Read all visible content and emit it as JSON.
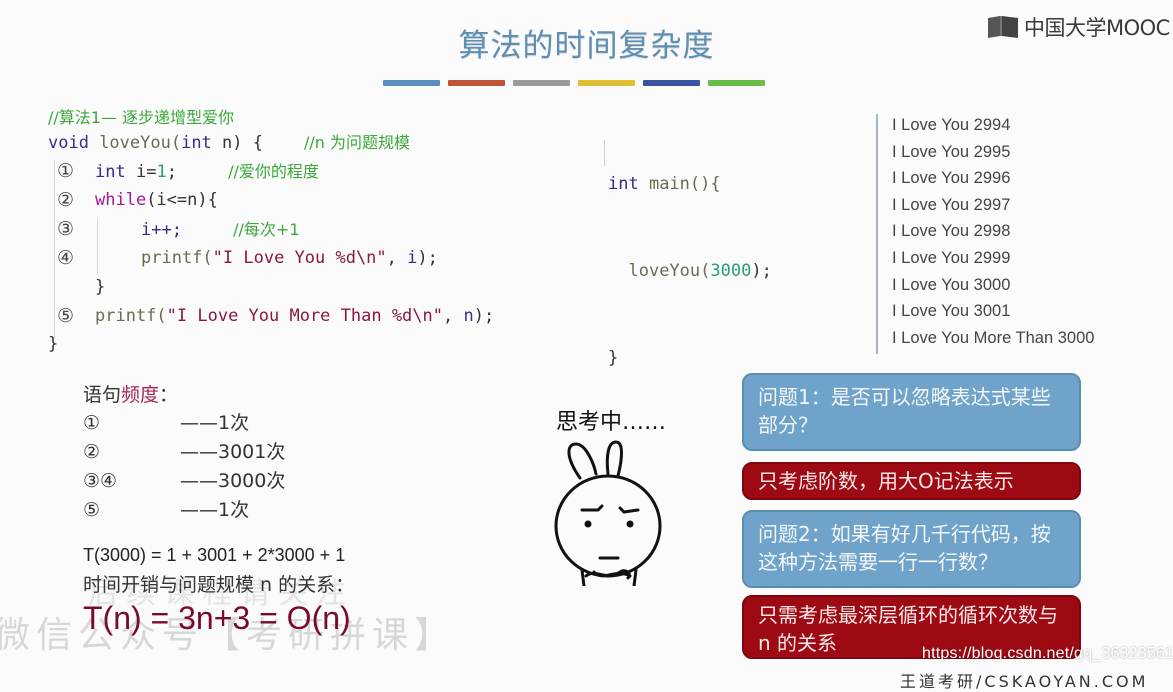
{
  "slide": {
    "title": "算法的时间复杂度",
    "accent_bars": [
      "#5b8fbf",
      "#c0553a",
      "#9a9a9a",
      "#e0c030",
      "#3a55a0",
      "#6bbd4a"
    ],
    "logo_text": "中国大学MOOC"
  },
  "code": {
    "comment_title": "//算法1— 逐步递增型爱你",
    "signature": {
      "kw": "void",
      "fn": " loveYou(",
      "kw2": "int",
      "rest": " n) {",
      "comment": "//n 为问题规模"
    },
    "lines": [
      {
        "no": "①",
        "kw": "int",
        "text": " i=",
        "num": "1",
        "end": ";",
        "comment": "//爱你的程度"
      },
      {
        "no": "②",
        "kw": "while",
        "text": "(i<=n){"
      },
      {
        "no": "③",
        "text": "i++;",
        "comment": "//每次+1"
      },
      {
        "no": "④",
        "fn": "printf(",
        "str": "\"I Love You %d\\n\"",
        "end": ", ",
        "var": "i",
        "close": ");"
      },
      {
        "no": "",
        "text": "}"
      },
      {
        "no": "⑤",
        "fn": "printf(",
        "str": "\"I Love You More Than %d\\n\"",
        "end": ", ",
        "var": "n",
        "close": ");"
      }
    ],
    "closing": "}"
  },
  "main_code": {
    "line1_kw": "int",
    "line1_rest": " main(){",
    "line2_fn": "loveYou(",
    "line2_num": "3000",
    "line2_end": ");",
    "line3": "}"
  },
  "output": [
    "I Love You 2994",
    "I Love You 2995",
    "I Love You 2996",
    "I Love You 2997",
    "I Love You 2998",
    "I Love You 2999",
    "I Love You 3000",
    "I Love You 3001",
    "I Love You More Than 3000"
  ],
  "frequency": {
    "title_prefix": "语句",
    "title_highlight": "频度",
    "title_suffix": "：",
    "rows": [
      {
        "label": "①",
        "value": "——1次"
      },
      {
        "label": "②",
        "value": "——3001次"
      },
      {
        "label": "③④",
        "value": "——3000次"
      },
      {
        "label": "⑤",
        "value": "——1次"
      }
    ]
  },
  "formulas": {
    "t3000": "T(3000) = 1 + 3001 + 2*3000 + 1",
    "relation": "时间开销与问题规模 n 的关系：",
    "big": "T(n) = 3n+3 = O(n)"
  },
  "thinking": {
    "label": "思考中……"
  },
  "bubbles": {
    "q1": "问题1：是否可以忽略表达式某些部分？",
    "a1": "只考虑阶数，用大O记法表示",
    "q2": "问题2：如果有好几千行代码，按这种方法需要一行一行数？",
    "a2": "只需考虑最深层循环的循环次数与 n 的关系"
  },
  "watermarks": {
    "wechat": "微信公众号【考研拼课】",
    "faded": "后续课程请关注",
    "csdn": "https://blog.csdn.net/qq_36323561",
    "bottom": "王道考研/CSKAOYAN.COM"
  }
}
